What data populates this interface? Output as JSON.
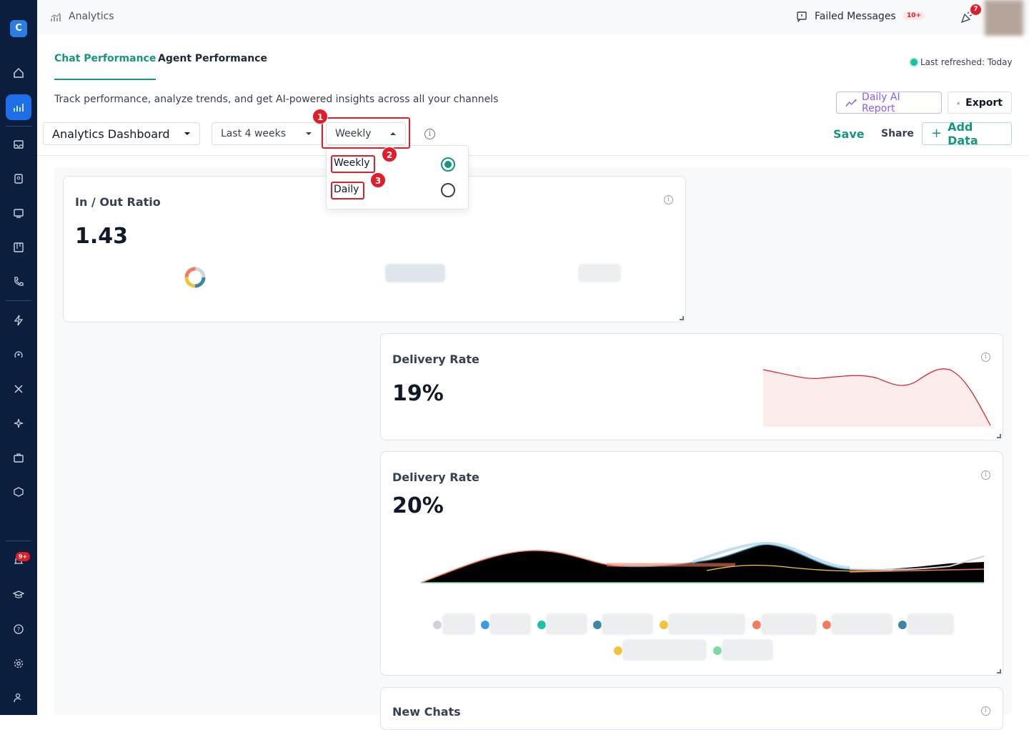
{
  "app": {
    "section_title": "Analytics"
  },
  "topbar": {
    "failed_messages_label": "Failed Messages",
    "failed_count": "10+",
    "notification_count": "7"
  },
  "sidebar": {
    "bell_badge": "9+"
  },
  "tabs": [
    {
      "label": "Chat Performance",
      "active": true
    },
    {
      "label": "Agent Performance",
      "active": false
    }
  ],
  "last_refreshed": "Last refreshed: Today",
  "subtitle": "Track performance, analyze trends, and get AI-powered insights across all your channels",
  "buttons": {
    "daily_ai_report": "Daily AI Report",
    "export": "Export",
    "save": "Save",
    "share": "Share",
    "add_data": "Add Data"
  },
  "filters": {
    "dashboard": "Analytics Dashboard",
    "range": "Last 4 weeks",
    "granularity": "Weekly"
  },
  "dropdown": {
    "options": [
      {
        "label": "Weekly",
        "selected": true
      },
      {
        "label": "Daily",
        "selected": false
      }
    ]
  },
  "annotations": [
    "1",
    "2",
    "3"
  ],
  "cards": {
    "in_out": {
      "title": "In / Out Ratio",
      "value": "1.43"
    },
    "delivery1": {
      "title": "Delivery Rate",
      "value": "19%"
    },
    "delivery2": {
      "title": "Delivery Rate",
      "value": "20%"
    },
    "new_chats": {
      "title": "New Chats"
    }
  },
  "colors": {
    "accent": "#14967f",
    "primary_blue": "#1d6fe8",
    "sidebar": "#0c1e3e",
    "alert_red": "#e11d2a",
    "ai_purple": "#8b5cf6"
  },
  "legend_colors": [
    "#cfd4dc",
    "#3b9be0",
    "#1fbfa4",
    "#3b86a8",
    "#f3c43a",
    "#f47b5e",
    "#f47b5e",
    "#3b86a8",
    "#f3c43a",
    "#7fd9a3"
  ]
}
